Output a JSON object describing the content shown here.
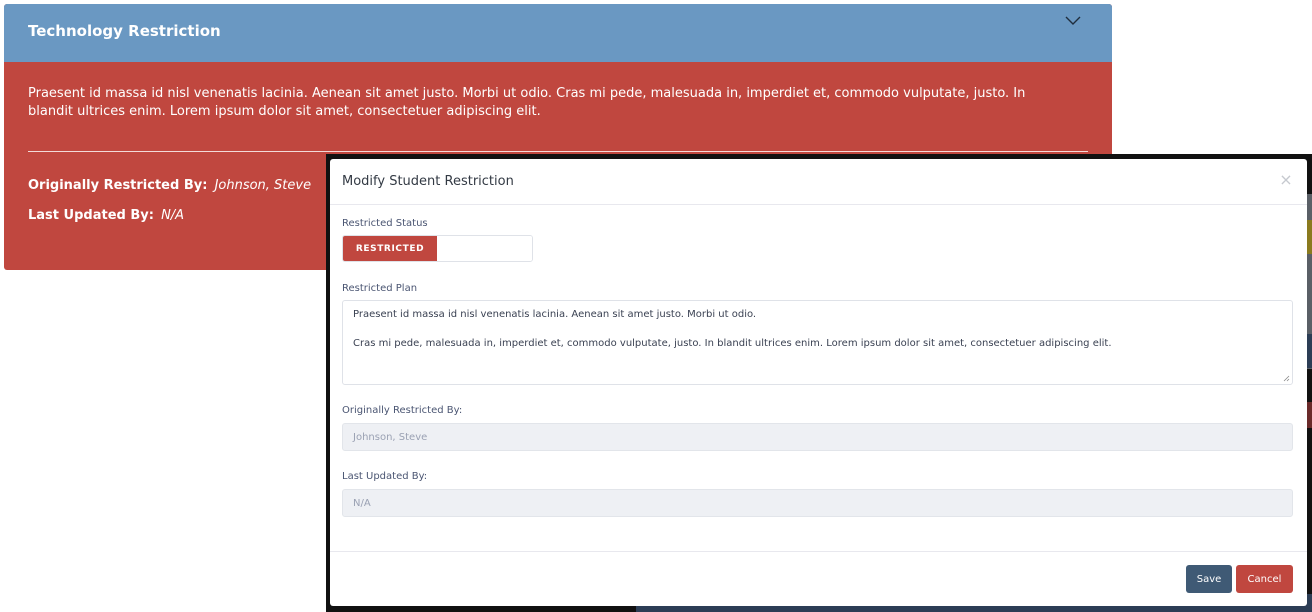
{
  "card": {
    "title": "Technology Restriction",
    "description": "Praesent id massa id nisl venenatis lacinia. Aenean sit amet justo. Morbi ut odio. Cras mi pede, malesuada in, imperdiet et, commodo vulputate, justo. In blandit ultrices enim. Lorem ipsum dolor sit amet, consectetuer adipiscing elit.",
    "originally_restricted_label": "Originally Restricted By:",
    "originally_restricted_value": "Johnson, Steve",
    "last_updated_label": "Last Updated By:",
    "last_updated_value": "N/A",
    "collapse_icon": "chevron-down-icon"
  },
  "modal": {
    "title": "Modify Student Restriction",
    "close_glyph": "×",
    "restricted_status_label": "Restricted Status",
    "toggle_label": "RESTRICTED",
    "restricted_plan_label": "Restricted Plan",
    "plan_line1": "Praesent id massa id nisl venenatis lacinia. Aenean sit amet justo. Morbi ut odio.",
    "plan_line2": "Cras mi pede, malesuada in, imperdiet et, commodo vulputate, justo. In blandit ultrices enim. Lorem ipsum dolor sit amet, consectetuer adipiscing elit.",
    "originally_restricted_label": "Originally Restricted By:",
    "originally_restricted_value": "Johnson, Steve",
    "last_updated_label": "Last Updated By:",
    "last_updated_value": "N/A",
    "save_label": "Save",
    "cancel_label": "Cancel"
  },
  "colors": {
    "restricted_red": "#c0473f",
    "header_blue": "#6a98c2",
    "save_button": "#3f5a75"
  }
}
